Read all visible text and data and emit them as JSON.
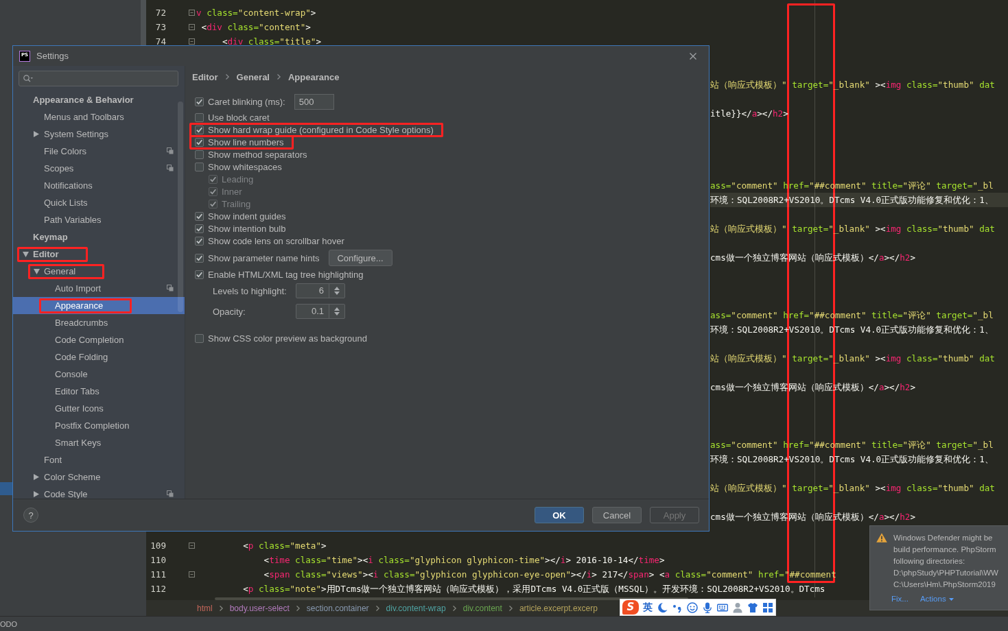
{
  "project_panel": {
    "selected_row": true
  },
  "editor": {
    "lines": [
      {
        "kind": "full",
        "number": "72",
        "fold_marker": true,
        "current": false,
        "segments": [
          {
            "kind": "tag",
            "text": "v"
          },
          {
            "kind": "attr",
            "text": " class="
          },
          {
            "kind": "string",
            "text": "\"content-wrap\""
          },
          {
            "kind": "text",
            "text": ">"
          }
        ]
      },
      {
        "kind": "full",
        "number": "73",
        "fold_marker": true,
        "current": false,
        "segments": [
          {
            "kind": "text",
            "text": " <"
          },
          {
            "kind": "tag",
            "text": "div"
          },
          {
            "kind": "attr",
            "text": " class="
          },
          {
            "kind": "string",
            "text": "\"content\""
          },
          {
            "kind": "text",
            "text": ">"
          }
        ]
      },
      {
        "kind": "full",
        "number": "74",
        "fold_marker": true,
        "current": false,
        "segments": [
          {
            "kind": "text",
            "text": "     <"
          },
          {
            "kind": "tag",
            "text": "div"
          },
          {
            "kind": "attr",
            "text": " class="
          },
          {
            "kind": "string",
            "text": "\"title\""
          },
          {
            "kind": "text",
            "text": ">"
          }
        ]
      },
      {
        "kind": "tail",
        "current": false,
        "segments": [
          {
            "kind": "string",
            "text": "站（响应式模板）\""
          },
          {
            "kind": "attr",
            "text": " target="
          },
          {
            "kind": "string",
            "text": "\"_blank\""
          },
          {
            "kind": "text",
            "text": " ><"
          },
          {
            "kind": "tag",
            "text": "img"
          },
          {
            "kind": "attr",
            "text": " class="
          },
          {
            "kind": "string",
            "text": "\"thumb\""
          },
          {
            "kind": "attr",
            "text": " dat"
          }
        ]
      },
      {
        "kind": "tail",
        "current": false,
        "segments": [
          {
            "kind": "text",
            "text": "itle}}</"
          },
          {
            "kind": "tag",
            "text": "a"
          },
          {
            "kind": "text",
            "text": "></"
          },
          {
            "kind": "tag",
            "text": "h2"
          },
          {
            "kind": "text",
            "text": ">"
          }
        ]
      },
      {
        "kind": "tail",
        "current": false,
        "segments": [
          {
            "kind": "attr",
            "text": "ass="
          },
          {
            "kind": "string",
            "text": "\"comment\""
          },
          {
            "kind": "attr",
            "text": " href="
          },
          {
            "kind": "string",
            "text": "\"##comment\""
          },
          {
            "kind": "attr",
            "text": " title="
          },
          {
            "kind": "string",
            "text": "\"评论\""
          },
          {
            "kind": "attr",
            "text": " target="
          },
          {
            "kind": "string",
            "text": "\"_bl"
          }
        ]
      },
      {
        "kind": "tail",
        "current": true,
        "segments": [
          {
            "kind": "text",
            "text": "环境：SQL2008R2+VS2010。DTcms V4.0正式版功能修复和优化：1、"
          }
        ]
      },
      {
        "kind": "tail",
        "current": false,
        "segments": [
          {
            "kind": "string",
            "text": "站（响应式模板）\""
          },
          {
            "kind": "attr",
            "text": " target="
          },
          {
            "kind": "string",
            "text": "\"_blank\""
          },
          {
            "kind": "text",
            "text": " ><"
          },
          {
            "kind": "tag",
            "text": "img"
          },
          {
            "kind": "attr",
            "text": " class="
          },
          {
            "kind": "string",
            "text": "\"thumb\""
          },
          {
            "kind": "attr",
            "text": " dat"
          }
        ]
      },
      {
        "kind": "tail",
        "current": false,
        "segments": [
          {
            "kind": "text",
            "text": "cms做一个独立博客网站（响应式模板）</"
          },
          {
            "kind": "tag",
            "text": "a"
          },
          {
            "kind": "text",
            "text": "></"
          },
          {
            "kind": "tag",
            "text": "h2"
          },
          {
            "kind": "text",
            "text": ">"
          }
        ]
      },
      {
        "kind": "tail",
        "current": false,
        "segments": [
          {
            "kind": "attr",
            "text": "ass="
          },
          {
            "kind": "string",
            "text": "\"comment\""
          },
          {
            "kind": "attr",
            "text": " href="
          },
          {
            "kind": "string",
            "text": "\"##comment\""
          },
          {
            "kind": "attr",
            "text": " title="
          },
          {
            "kind": "string",
            "text": "\"评论\""
          },
          {
            "kind": "attr",
            "text": " target="
          },
          {
            "kind": "string",
            "text": "\"_bl"
          }
        ]
      },
      {
        "kind": "tail",
        "current": false,
        "segments": [
          {
            "kind": "text",
            "text": "环境：SQL2008R2+VS2010。DTcms V4.0正式版功能修复和优化：1、"
          }
        ]
      },
      {
        "kind": "tail",
        "current": false,
        "segments": [
          {
            "kind": "string",
            "text": "站（响应式模板）\""
          },
          {
            "kind": "attr",
            "text": " target="
          },
          {
            "kind": "string",
            "text": "\"_blank\""
          },
          {
            "kind": "text",
            "text": " ><"
          },
          {
            "kind": "tag",
            "text": "img"
          },
          {
            "kind": "attr",
            "text": " class="
          },
          {
            "kind": "string",
            "text": "\"thumb\""
          },
          {
            "kind": "attr",
            "text": " dat"
          }
        ]
      },
      {
        "kind": "tail",
        "current": false,
        "segments": [
          {
            "kind": "text",
            "text": "cms做一个独立博客网站（响应式模板）</"
          },
          {
            "kind": "tag",
            "text": "a"
          },
          {
            "kind": "text",
            "text": "></"
          },
          {
            "kind": "tag",
            "text": "h2"
          },
          {
            "kind": "text",
            "text": ">"
          }
        ]
      },
      {
        "kind": "tail",
        "current": false,
        "segments": [
          {
            "kind": "attr",
            "text": "ass="
          },
          {
            "kind": "string",
            "text": "\"comment\""
          },
          {
            "kind": "attr",
            "text": " href="
          },
          {
            "kind": "string",
            "text": "\"##comment\""
          },
          {
            "kind": "attr",
            "text": " title="
          },
          {
            "kind": "string",
            "text": "\"评论\""
          },
          {
            "kind": "attr",
            "text": " target="
          },
          {
            "kind": "string",
            "text": "\"_bl"
          }
        ]
      },
      {
        "kind": "tail",
        "current": false,
        "segments": [
          {
            "kind": "text",
            "text": "环境：SQL2008R2+VS2010。DTcms V4.0正式版功能修复和优化：1、"
          }
        ]
      },
      {
        "kind": "tail",
        "current": false,
        "segments": [
          {
            "kind": "string",
            "text": "站（响应式模板）\""
          },
          {
            "kind": "attr",
            "text": " target="
          },
          {
            "kind": "string",
            "text": "\"_blank\""
          },
          {
            "kind": "text",
            "text": " ><"
          },
          {
            "kind": "tag",
            "text": "img"
          },
          {
            "kind": "attr",
            "text": " class="
          },
          {
            "kind": "string",
            "text": "\"thumb\""
          },
          {
            "kind": "attr",
            "text": " dat"
          }
        ]
      },
      {
        "kind": "tail",
        "current": false,
        "segments": [
          {
            "kind": "text",
            "text": "cms做一个独立博客网站（响应式模板）</"
          },
          {
            "kind": "tag",
            "text": "a"
          },
          {
            "kind": "text",
            "text": "></"
          },
          {
            "kind": "tag",
            "text": "h2"
          },
          {
            "kind": "text",
            "text": ">"
          }
        ]
      },
      {
        "kind": "full",
        "number": "109",
        "fold_marker": true,
        "current": false,
        "segments": [
          {
            "kind": "text",
            "text": "         <"
          },
          {
            "kind": "tag",
            "text": "p"
          },
          {
            "kind": "attr",
            "text": " class="
          },
          {
            "kind": "string",
            "text": "\"meta\""
          },
          {
            "kind": "text",
            "text": ">"
          }
        ]
      },
      {
        "kind": "full",
        "number": "110",
        "fold_marker": false,
        "current": false,
        "segments": [
          {
            "kind": "text",
            "text": "             <"
          },
          {
            "kind": "tag",
            "text": "time"
          },
          {
            "kind": "attr",
            "text": " class="
          },
          {
            "kind": "string",
            "text": "\"time\""
          },
          {
            "kind": "text",
            "text": "><"
          },
          {
            "kind": "tag",
            "text": "i"
          },
          {
            "kind": "attr",
            "text": " class="
          },
          {
            "kind": "string",
            "text": "\"glyphicon glyphicon-time\""
          },
          {
            "kind": "text",
            "text": "></"
          },
          {
            "kind": "tag",
            "text": "i"
          },
          {
            "kind": "text",
            "text": "> 2016-10-14</"
          },
          {
            "kind": "tag",
            "text": "time"
          },
          {
            "kind": "text",
            "text": ">"
          }
        ]
      },
      {
        "kind": "full",
        "number": "111",
        "fold_marker": true,
        "current": false,
        "segments": [
          {
            "kind": "text",
            "text": "             <"
          },
          {
            "kind": "tag",
            "text": "span"
          },
          {
            "kind": "attr",
            "text": " class="
          },
          {
            "kind": "string",
            "text": "\"views\""
          },
          {
            "kind": "text",
            "text": "><"
          },
          {
            "kind": "tag",
            "text": "i"
          },
          {
            "kind": "attr",
            "text": " class="
          },
          {
            "kind": "string",
            "text": "\"glyphicon glyphicon-eye-open\""
          },
          {
            "kind": "text",
            "text": "></"
          },
          {
            "kind": "tag",
            "text": "i"
          },
          {
            "kind": "text",
            "text": "> 217</"
          },
          {
            "kind": "tag",
            "text": "span"
          },
          {
            "kind": "text",
            "text": "> <"
          },
          {
            "kind": "tag",
            "text": "a"
          },
          {
            "kind": "attr",
            "text": " class="
          },
          {
            "kind": "string",
            "text": "\"comment\""
          },
          {
            "kind": "attr",
            "text": " href="
          },
          {
            "kind": "string",
            "text": "\"##comment"
          }
        ]
      },
      {
        "kind": "full",
        "number": "112",
        "fold_marker": false,
        "current": false,
        "segments": [
          {
            "kind": "text",
            "text": "         <"
          },
          {
            "kind": "tag",
            "text": "p"
          },
          {
            "kind": "attr",
            "text": " class="
          },
          {
            "kind": "string",
            "text": "\"note\""
          },
          {
            "kind": "text",
            "text": ">用DTcms做一个独立博客网站（响应式模板），采用DTcms V4.0正式版（MSSQL）。开发环境：SQL2008R2+VS2010。DTcms"
          }
        ]
      }
    ],
    "wrap_guide": {
      "annotated": true
    },
    "breadcrumbs": [
      {
        "label": "html",
        "color": "#c4665a"
      },
      {
        "label": "body.user-select",
        "color": "#b27bbd"
      },
      {
        "label": "section.container",
        "color": "#8899b0"
      },
      {
        "label": "div.content-wrap",
        "color": "#4fa3a3"
      },
      {
        "label": "div.content",
        "color": "#69a550"
      },
      {
        "label": "article.excerpt.excerp",
        "color": "#b3a25c"
      }
    ]
  },
  "status_bar": {
    "tool_window": "ODO"
  },
  "dialog": {
    "logo": "PS",
    "title": "Settings",
    "tree": [
      {
        "label": "Appearance & Behavior",
        "selected": false,
        "annotated": false,
        "project_icon": false,
        "children": [
          {
            "label": "Menus and Toolbars",
            "selected": false,
            "annotated": false,
            "project_icon": false
          },
          {
            "label": "System Settings",
            "expanded": false,
            "selected": false,
            "annotated": false,
            "project_icon": false
          },
          {
            "label": "File Colors",
            "selected": false,
            "annotated": false,
            "project_icon": true
          },
          {
            "label": "Scopes",
            "selected": false,
            "annotated": false,
            "project_icon": true
          },
          {
            "label": "Notifications",
            "selected": false,
            "annotated": false,
            "project_icon": false
          },
          {
            "label": "Quick Lists",
            "selected": false,
            "annotated": false,
            "project_icon": false
          },
          {
            "label": "Path Variables",
            "selected": false,
            "annotated": false,
            "project_icon": false
          }
        ]
      },
      {
        "label": "Keymap",
        "selected": false,
        "annotated": false,
        "project_icon": false
      },
      {
        "label": "Editor",
        "expanded": true,
        "selected": false,
        "annotated": true,
        "project_icon": false,
        "children": [
          {
            "label": "General",
            "expanded": true,
            "selected": false,
            "annotated": true,
            "project_icon": false,
            "children": [
              {
                "label": "Auto Import",
                "selected": false,
                "annotated": false,
                "project_icon": true
              },
              {
                "label": "Appearance",
                "selected": true,
                "annotated": true,
                "project_icon": false
              },
              {
                "label": "Breadcrumbs",
                "selected": false,
                "annotated": false,
                "project_icon": false
              },
              {
                "label": "Code Completion",
                "selected": false,
                "annotated": false,
                "project_icon": false
              },
              {
                "label": "Code Folding",
                "selected": false,
                "annotated": false,
                "project_icon": false
              },
              {
                "label": "Console",
                "selected": false,
                "annotated": false,
                "project_icon": false
              },
              {
                "label": "Editor Tabs",
                "selected": false,
                "annotated": false,
                "project_icon": false
              },
              {
                "label": "Gutter Icons",
                "selected": false,
                "annotated": false,
                "project_icon": false
              },
              {
                "label": "Postfix Completion",
                "selected": false,
                "annotated": false,
                "project_icon": false
              },
              {
                "label": "Smart Keys",
                "selected": false,
                "annotated": false,
                "project_icon": false
              }
            ]
          },
          {
            "label": "Font",
            "selected": false,
            "annotated": false,
            "project_icon": false
          },
          {
            "label": "Color Scheme",
            "expanded": false,
            "selected": false,
            "annotated": false,
            "project_icon": false
          },
          {
            "label": "Code Style",
            "expanded": false,
            "selected": false,
            "annotated": false,
            "project_icon": true
          }
        ]
      }
    ],
    "breadcrumb": [
      "Editor",
      "General",
      "Appearance"
    ],
    "options": [
      {
        "kind": "checkbox_input",
        "label": "Caret blinking (ms):",
        "checked": true,
        "annotated": false,
        "value": "500"
      },
      {
        "kind": "checkbox",
        "label": "Use block caret",
        "checked": false,
        "annotated": false
      },
      {
        "kind": "checkbox",
        "label": "Show hard wrap guide (configured in Code Style options)",
        "checked": true,
        "annotated": true
      },
      {
        "kind": "checkbox",
        "label": "Show line numbers",
        "checked": true,
        "annotated": true
      },
      {
        "kind": "checkbox",
        "label": "Show method separators",
        "checked": false,
        "annotated": false
      },
      {
        "kind": "checkbox",
        "label": "Show whitespaces",
        "checked": false,
        "annotated": false,
        "children": [
          {
            "kind": "checkbox",
            "label": "Leading",
            "checked": true,
            "disabled": true
          },
          {
            "kind": "checkbox",
            "label": "Inner",
            "checked": true,
            "disabled": true
          },
          {
            "kind": "checkbox",
            "label": "Trailing",
            "checked": true,
            "disabled": true
          }
        ]
      },
      {
        "kind": "checkbox",
        "label": "Show indent guides",
        "checked": true,
        "annotated": false
      },
      {
        "kind": "checkbox",
        "label": "Show intention bulb",
        "checked": true,
        "annotated": false
      },
      {
        "kind": "checkbox",
        "label": "Show code lens on scrollbar hover",
        "checked": true,
        "annotated": false
      },
      {
        "kind": "checkbox_button",
        "label": "Show parameter name hints",
        "checked": true,
        "annotated": false,
        "button": "Configure..."
      },
      {
        "kind": "checkbox",
        "label": "Enable HTML/XML tag tree highlighting",
        "checked": true,
        "annotated": false,
        "children": [
          {
            "kind": "spinner",
            "label": "Levels to highlight:",
            "value": "6"
          },
          {
            "kind": "spinner",
            "label": "Opacity:",
            "value": "0.1"
          }
        ]
      },
      {
        "kind": "checkbox",
        "label": "Show CSS color preview as background",
        "checked": false,
        "annotated": false
      }
    ],
    "help": "?",
    "buttons": [
      {
        "label": "OK",
        "default": true,
        "disabled": false
      },
      {
        "label": "Cancel",
        "default": false,
        "disabled": false
      },
      {
        "label": "Apply",
        "default": false,
        "disabled": true
      }
    ]
  },
  "notification": {
    "lines": [
      "Windows Defender might be",
      "build performance. PhpStorm",
      "following directories:",
      "D:\\phpStudy\\PHPTutorial\\WW",
      "C:\\Users\\Hm\\.PhpStorm2019"
    ],
    "actions": [
      {
        "label": "Fix...",
        "menu": false
      },
      {
        "label": "Actions",
        "menu": true
      }
    ]
  },
  "ime_toolbar": {
    "logo": "S",
    "mode": "英"
  }
}
